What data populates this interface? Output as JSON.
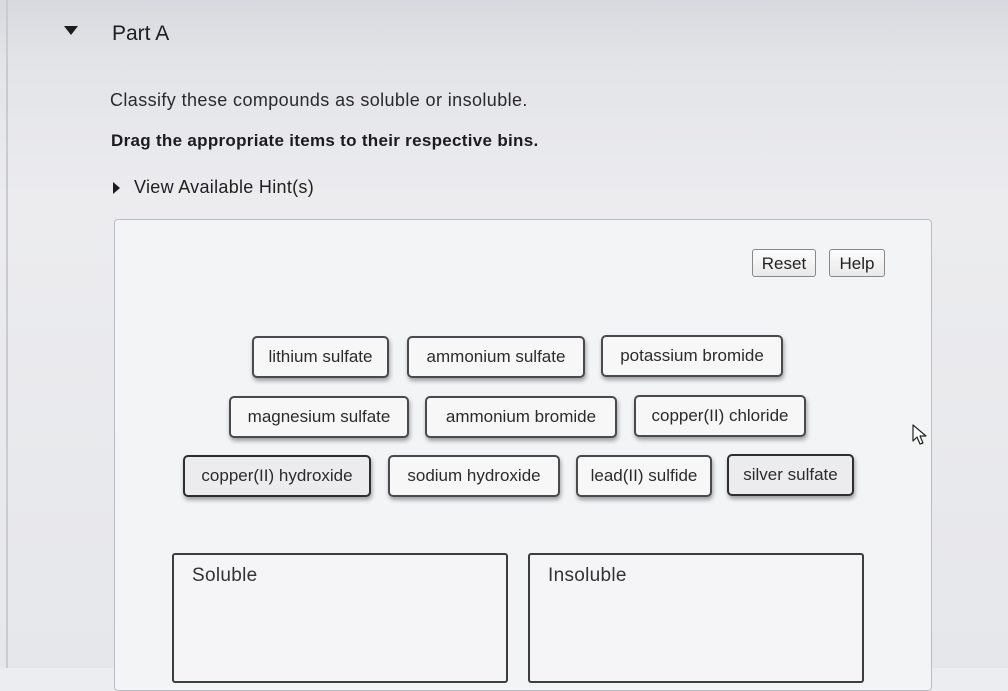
{
  "part": {
    "title": "Part A"
  },
  "instructions": {
    "text": "Classify these compounds as soluble or insoluble.",
    "bold_text": "Drag the appropriate items to their respective bins."
  },
  "hints": {
    "label": "View Available Hint(s)"
  },
  "controls": {
    "reset_label": "Reset",
    "help_label": "Help"
  },
  "items": [
    "lithium sulfate",
    "ammonium sulfate",
    "potassium bromide",
    "magnesium sulfate",
    "ammonium bromide",
    "copper(II) chloride",
    "copper(II) hydroxide",
    "sodium hydroxide",
    "lead(II) sulfide",
    "silver sulfate"
  ],
  "bins": {
    "soluble_label": "Soluble",
    "insoluble_label": "Insoluble"
  },
  "icons": {
    "collapse": "caret-down-icon",
    "hints": "caret-right-icon",
    "cursor": "mouse-pointer-icon"
  }
}
